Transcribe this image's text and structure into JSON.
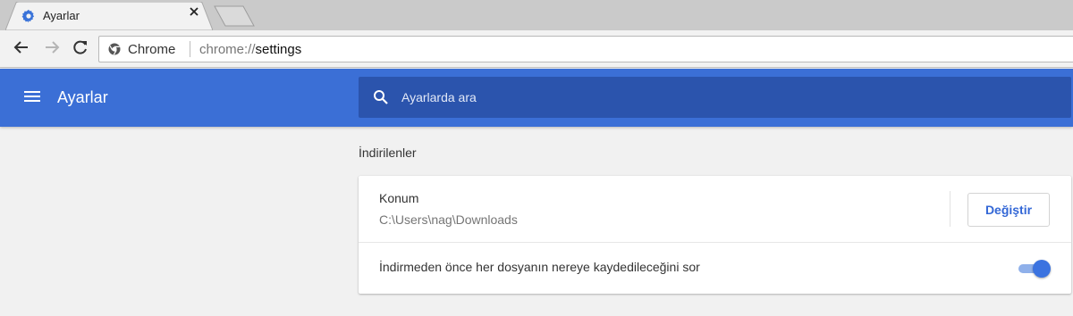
{
  "tab": {
    "title": "Ayarlar",
    "icon": "gear-icon",
    "close_symbol": "×"
  },
  "toolbar": {
    "back_icon": "arrow-left-icon",
    "forward_icon": "arrow-right-icon",
    "reload_icon": "reload-icon",
    "chip": "Chrome",
    "url_scheme": "chrome://",
    "url_host": "settings"
  },
  "header": {
    "title": "Ayarlar",
    "search_placeholder": "Ayarlarda ara"
  },
  "downloads": {
    "section_title": "İndirilenler",
    "location_label": "Konum",
    "location_path": "C:\\Users\\nag\\Downloads",
    "change_label": "Değiştir",
    "ask_label": "İndirmeden önce her dosyanın nereye kaydedileceğini sor",
    "ask_enabled": true
  },
  "colors": {
    "header_bg": "#3b6fd6",
    "search_bg": "#2b54ad",
    "accent": "#3367d6"
  }
}
